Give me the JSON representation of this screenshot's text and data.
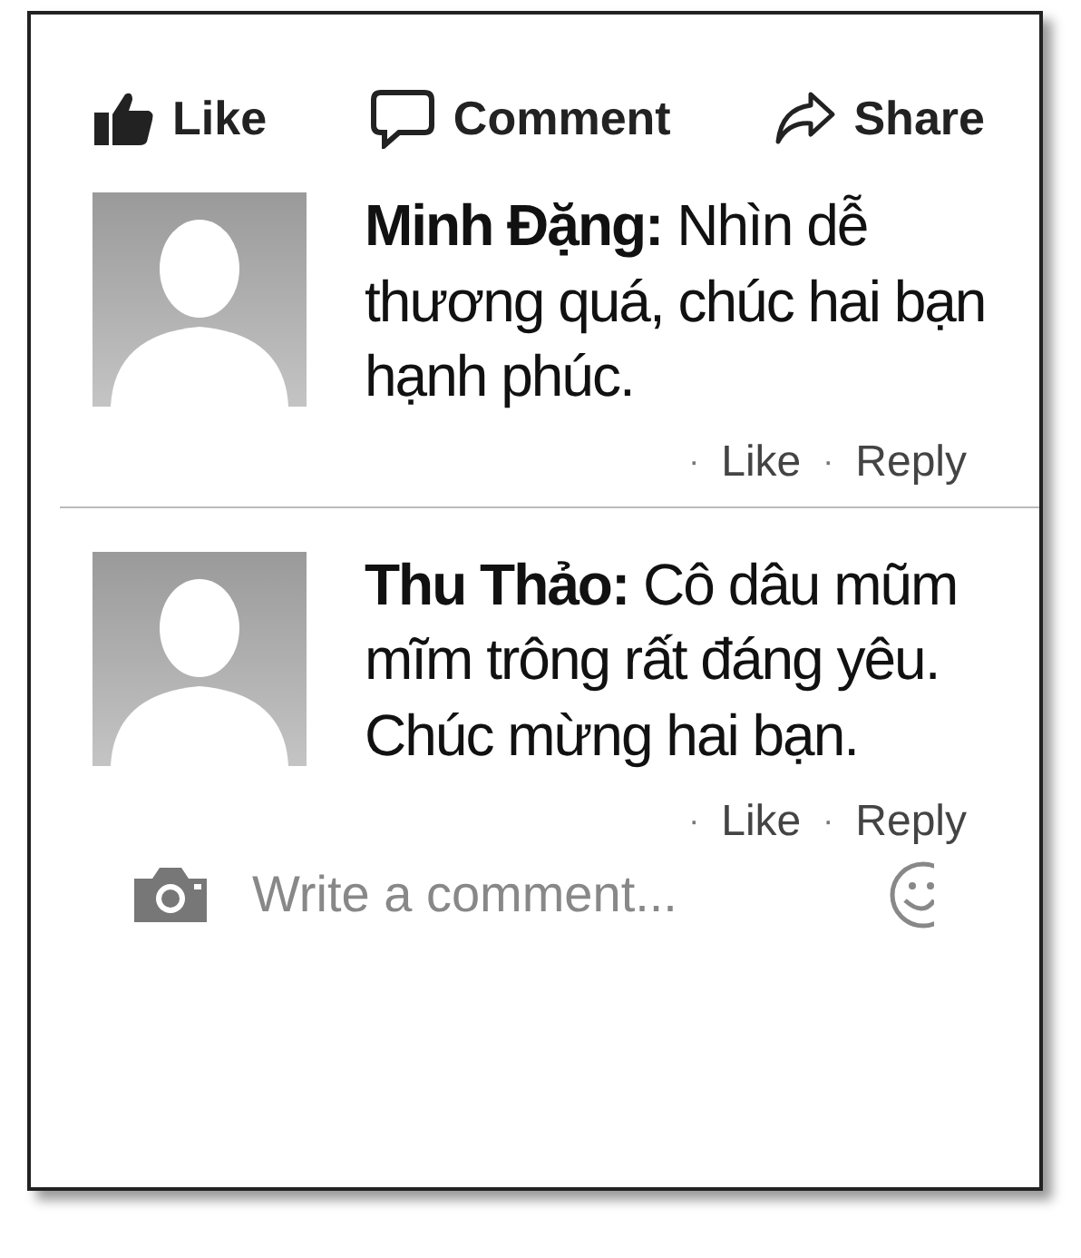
{
  "actions": [
    {
      "kind": "like",
      "label": "Like"
    },
    {
      "kind": "comment",
      "label": "Comment"
    },
    {
      "kind": "share",
      "label": "Share"
    }
  ],
  "comments": [
    {
      "text": "**Minh Đặng:** Nhìn dễ thương quá, chúc hai bạn hạnh phúc.",
      "dot": "·",
      "like": "Like",
      "reply": "Reply"
    },
    {
      "text": "**Thu Thảo:** Cô dâu mũm mĩm trông rất đáng yêu. Chúc mừng hai bạn.",
      "dot": "·",
      "like": "Like",
      "reply": "Reply"
    }
  ],
  "composer": {
    "placeholder": "Write a comment..."
  }
}
